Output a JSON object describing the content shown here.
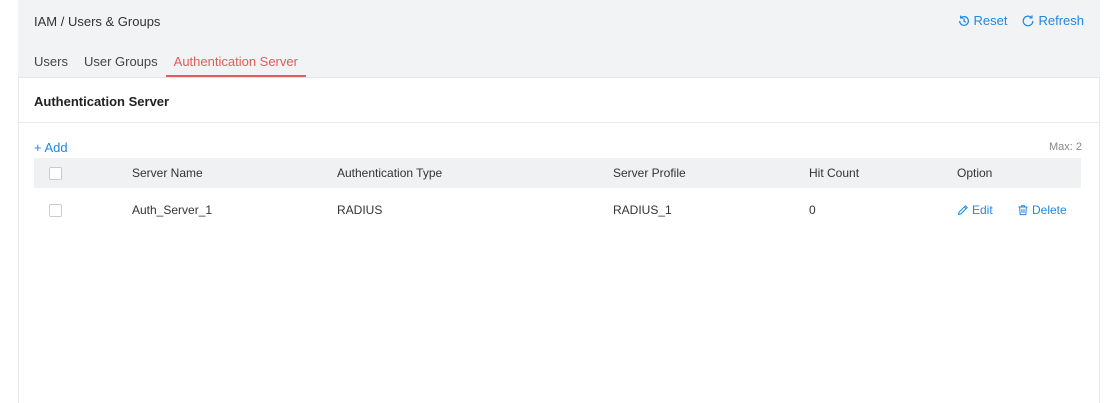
{
  "header": {
    "breadcrumb": "IAM / Users & Groups",
    "reset_label": "Reset",
    "refresh_label": "Refresh"
  },
  "tabs": [
    {
      "label": "Users",
      "active": false
    },
    {
      "label": "User Groups",
      "active": false
    },
    {
      "label": "Authentication Server",
      "active": true
    }
  ],
  "panel": {
    "title": "Authentication Server",
    "add_label": "+ Add",
    "max_label": "Max: 2"
  },
  "table": {
    "columns": [
      "Server Name",
      "Authentication Type",
      "Server Profile",
      "Hit Count",
      "Option"
    ],
    "rows": [
      {
        "server_name": "Auth_Server_1",
        "auth_type": "RADIUS",
        "server_profile": "RADIUS_1",
        "hit_count": "0",
        "edit_label": "Edit",
        "delete_label": "Delete"
      }
    ]
  },
  "colors": {
    "accent": "#1e88e5",
    "active_tab": "#e35b5b",
    "background": "#f2f3f5"
  }
}
